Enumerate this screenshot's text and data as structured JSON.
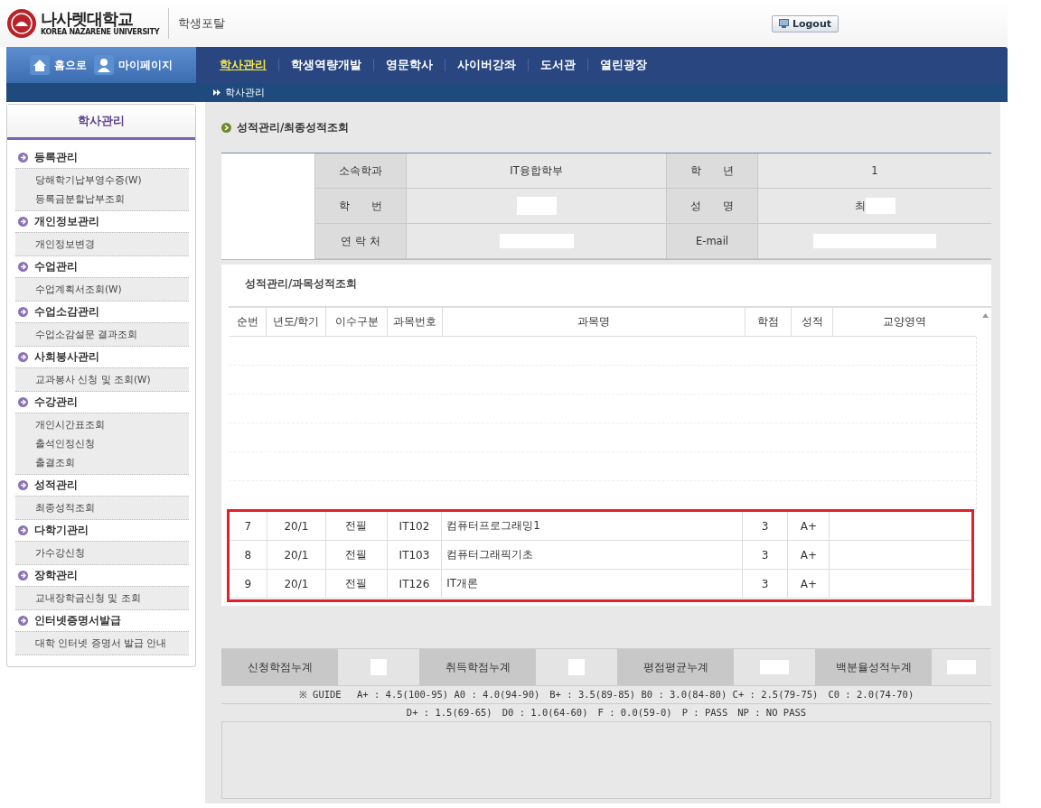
{
  "header": {
    "logo_name": "나사렛대학교",
    "logo_sub": "KOREA NAZARENE UNIVERSITY",
    "portal": "학생포탈",
    "logout": "Logout"
  },
  "quick_links": [
    {
      "kind": "home",
      "label": "홈으로"
    },
    {
      "kind": "user",
      "label": "마이페이지"
    }
  ],
  "nav": [
    {
      "label": "학사관리",
      "selected": true
    },
    {
      "label": "학생역량개발",
      "selected": false
    },
    {
      "label": "영문학사",
      "selected": false
    },
    {
      "label": "사이버강좌",
      "selected": false
    },
    {
      "label": "도서관",
      "selected": false
    },
    {
      "label": "열린광장",
      "selected": false
    }
  ],
  "breadcrumb": "학사관리",
  "sidebar": {
    "title": "학사관리",
    "groups": [
      {
        "title": "등록관리",
        "items": [
          "당해학기납부영수증(W)",
          "등록금분할납부조회"
        ]
      },
      {
        "title": "개인정보관리",
        "items": [
          "개인정보변경"
        ]
      },
      {
        "title": "수업관리",
        "items": [
          "수업계획서조회(W)"
        ]
      },
      {
        "title": "수업소감관리",
        "items": [
          "수업소감설문 결과조회"
        ]
      },
      {
        "title": "사회봉사관리",
        "items": [
          "교과봉사 신청 및 조회(W)"
        ]
      },
      {
        "title": "수강관리",
        "items": [
          "개인시간표조회",
          "출석인정신청",
          "출결조회"
        ]
      },
      {
        "title": "성적관리",
        "items": [
          "최종성적조회"
        ]
      },
      {
        "title": "다학기관리",
        "items": [
          "가수강신청"
        ]
      },
      {
        "title": "장학관리",
        "items": [
          "교내장학금신청 및 조회"
        ]
      },
      {
        "title": "인터넷증명서발급",
        "items": [
          "대학 인터넷 증명서 발급 안내"
        ]
      }
    ]
  },
  "page_title": "성적관리/최종성적조회",
  "profile": [
    [
      {
        "label": "소속학과",
        "value": "IT융합학부",
        "redacted": false
      },
      {
        "label": "학　　년",
        "value": "1",
        "redacted": false
      }
    ],
    [
      {
        "label": "학　　번",
        "redacted": true
      },
      {
        "label": "성　　명",
        "value": "최",
        "redacted": true
      }
    ],
    [
      {
        "label": "연 락 처",
        "redacted": true
      },
      {
        "label": "E-mail",
        "redacted": true
      }
    ]
  ],
  "grades": {
    "title": "성적관리/과목성적조회",
    "columns": [
      "순번",
      "년도/학기",
      "이수구분",
      "과목번호",
      "과목명",
      "학점",
      "성적",
      "교양영역"
    ],
    "rows": [
      [
        "7",
        "20/1",
        "전필",
        "IT102",
        "컴퓨터프로그래밍1",
        "3",
        "A+"
      ],
      [
        "8",
        "20/1",
        "전필",
        "IT103",
        "컴퓨터그래픽기초",
        "3",
        "A+"
      ],
      [
        "9",
        "20/1",
        "전필",
        "IT126",
        "IT개론",
        "3",
        "A+"
      ]
    ]
  },
  "summary": [
    {
      "label": "신청학점누계",
      "redacted": true
    },
    {
      "label": "취득학점누계",
      "redacted": true
    },
    {
      "label": "평점평균누계",
      "redacted": true
    },
    {
      "label": "백분율성적누계",
      "redacted": true
    }
  ],
  "guide": [
    "※ GUIDE　 A+ : 4.5(100-95) A0 : 4.0(94-90)　B+ : 3.5(89-85) B0 : 3.0(84-80) C+ : 2.5(79-75)　C0 : 2.0(74-70)",
    "D+ : 1.5(69-65)　D0 : 1.0(64-60)　F : 0.0(59-0)　P : PASS　NP : NO PASS"
  ]
}
